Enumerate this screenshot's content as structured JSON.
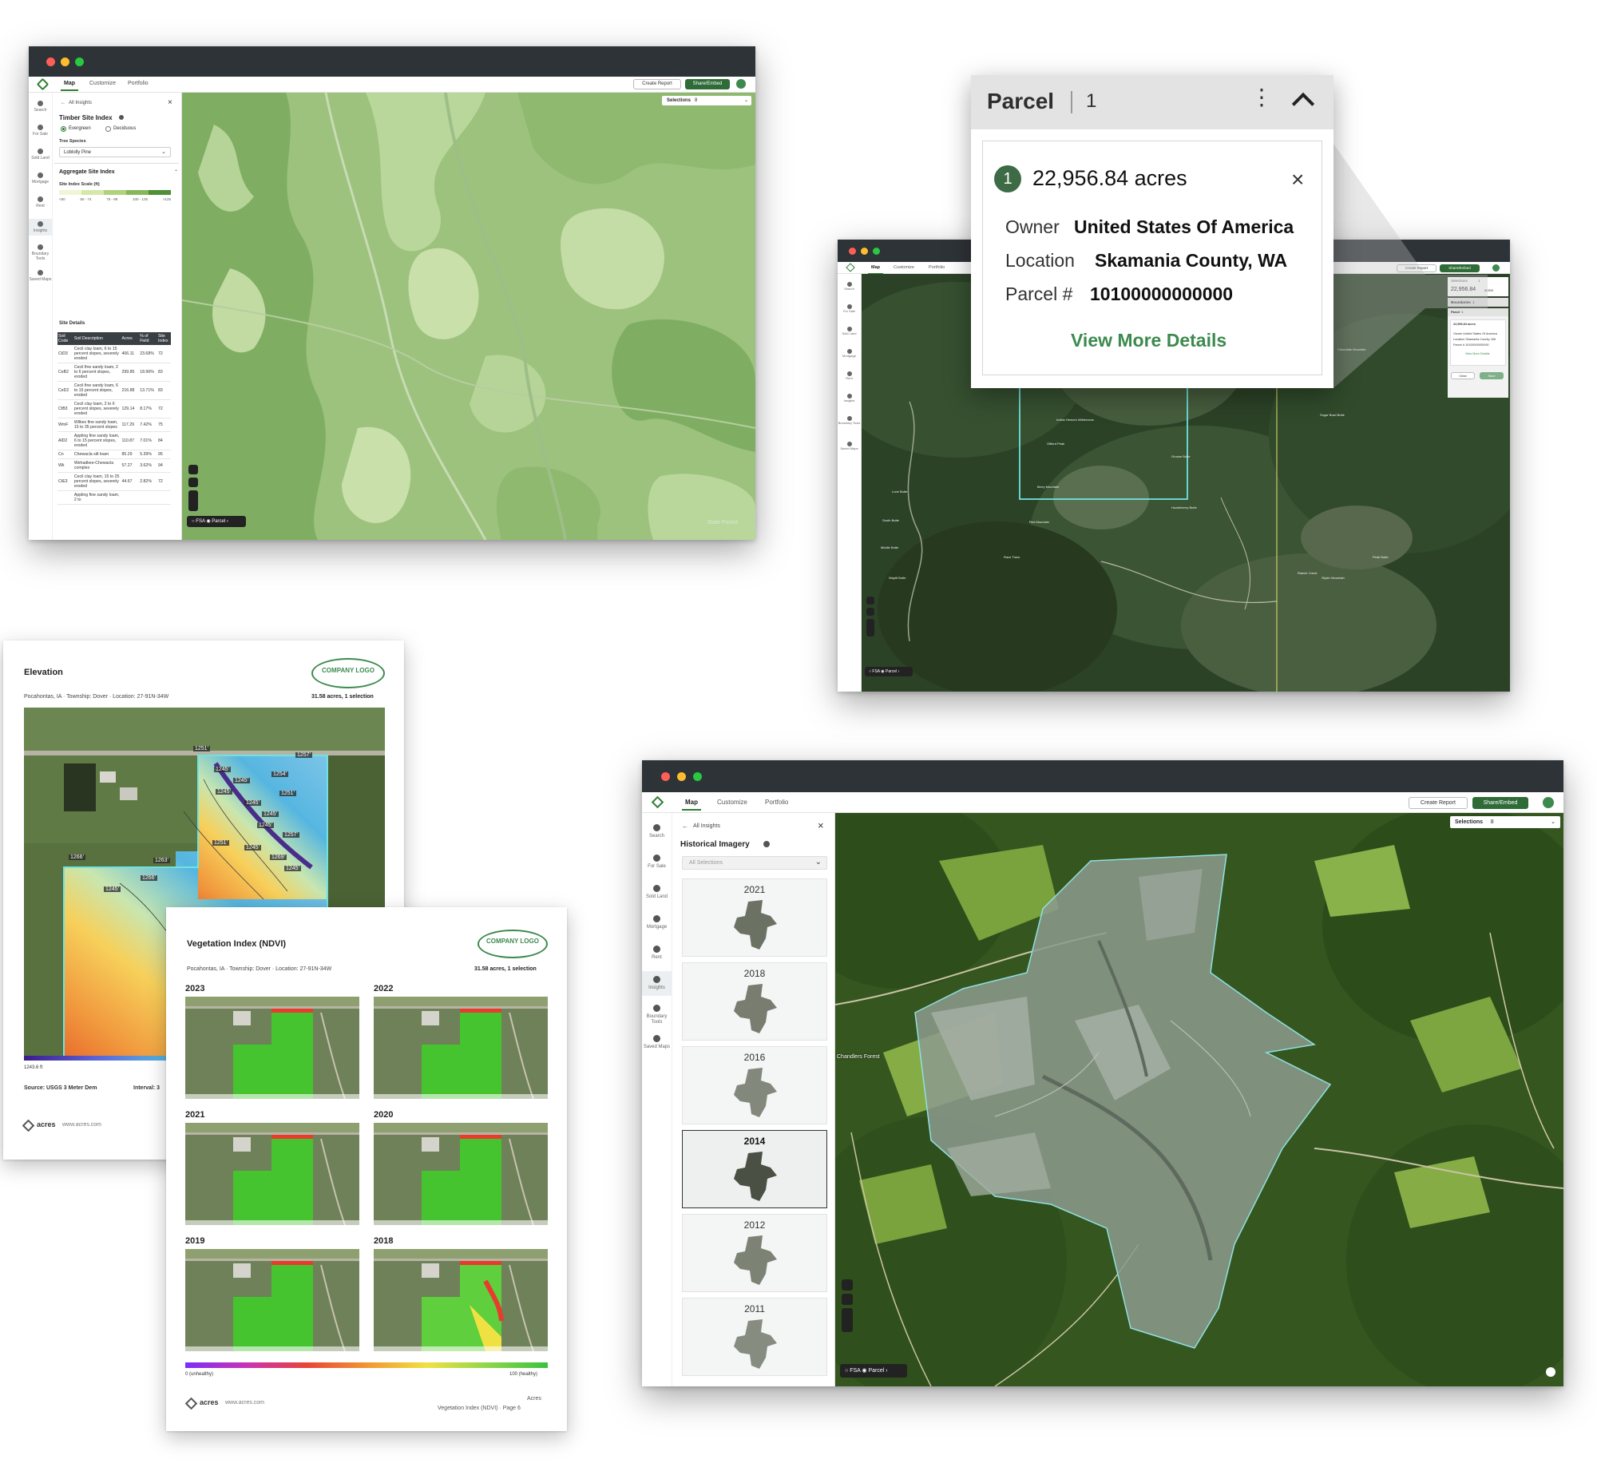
{
  "colors": {
    "brand_green": "#2e6b37",
    "accent_green": "#3c8a4e",
    "titlebar": "#2e3338",
    "traffic_red": "#ff5f57",
    "traffic_yellow": "#febc2e",
    "traffic_green": "#28c840"
  },
  "app": {
    "tabs": [
      "Map",
      "Customize",
      "Portfolio"
    ],
    "create_report": "Create Report",
    "share_embed": "Share/Embed",
    "selections_label": "Selections",
    "selections_count": "8",
    "rail": [
      "Search",
      "For Sale",
      "Sold Land",
      "Mortgage",
      "Rent",
      "Insights",
      "Boundary Tools",
      "Saved Maps"
    ],
    "rail_icons": [
      "search-icon",
      "for-sale-icon",
      "sold-land-icon",
      "mortgage-icon",
      "rent-icon",
      "insights-icon",
      "boundary-tools-icon",
      "saved-maps-icon"
    ],
    "fsa_label": "FSA",
    "parcel_label": "Parcel"
  },
  "timber_window": {
    "back_label": "All Insights",
    "title": "Timber Site Index",
    "radio_evergreen": "Evergreen",
    "radio_deciduous": "Deciduous",
    "tree_species_label": "Tree Species",
    "tree_species_value": "Loblolly Pine",
    "aggregate_title": "Aggregate Site Index",
    "scale_label": "Site Index Scale (ft)",
    "scale_ticks": [
      "<50",
      "50 - 74",
      "75 - 99",
      "100 - 125",
      ">125"
    ],
    "scale_colors": [
      "#f1f5d6",
      "#d6e8a8",
      "#b1d27c",
      "#86b85a",
      "#4f8f37"
    ],
    "site_details_label": "Site Details",
    "table_headers": [
      "Soil Code",
      "Soil Description",
      "Acres",
      "% of Field",
      "Site Index"
    ],
    "table_rows": [
      [
        "CtD3",
        "Cecil clay loam, 6 to 15 percent slopes, severely eroded",
        "406.11",
        "23.68%",
        "72"
      ],
      [
        "CeB2",
        "Cecil fine sandy loam, 2 to 6 percent slopes, eroded",
        "299.85",
        "18.96%",
        "83"
      ],
      [
        "CeD2",
        "Cecil fine sandy loam, 6 to 15 percent slopes, eroded",
        "216.88",
        "13.71%",
        "83"
      ],
      [
        "CtB3",
        "Cecil clay loam, 2 to 6 percent slopes, severely eroded",
        "129.14",
        "8.17%",
        "72"
      ],
      [
        "WmF",
        "Wilkes fine sandy loam, 15 to 35 percent slopes",
        "117.29",
        "7.42%",
        "75"
      ],
      [
        "AlD2",
        "Appling fine sandy loam, 6 to 15 percent slopes, eroded",
        "110.87",
        "7.01%",
        "84"
      ],
      [
        "Cn",
        "Chewacla silt loam",
        "85.29",
        "5.39%",
        "95"
      ],
      [
        "Wk",
        "Wehadkee-Chewacla complex",
        "57.27",
        "3.62%",
        "94"
      ],
      [
        "CtE3",
        "Cecil clay loam, 15 to 25 percent slopes, severely eroded",
        "44.67",
        "2.82%",
        "72"
      ],
      [
        "",
        "Appling fine sandy loam, 2 to",
        "",
        "",
        ""
      ]
    ],
    "map_caption": "State Forest"
  },
  "parcel_popup": {
    "title": "Parcel",
    "count": "1",
    "badge": "1",
    "acres": "22,956.84 acres",
    "owner_label": "Owner",
    "owner_value": "United States Of America",
    "location_label": "Location",
    "location_value": "Skamania County, WA",
    "parcel_label": "Parcel #",
    "parcel_value": "10100000000000",
    "link": "View More Details"
  },
  "parcel_window": {
    "selections_label": "Selections",
    "selections_count": "1",
    "selections_acres": "22,956.84",
    "selections_unit": "acres",
    "boundaries_label": "Boundaries",
    "boundaries_count": "1",
    "parcel_label": "Parcel",
    "parcel_count": "1",
    "mini_acres": "22,956.84 acres",
    "mini_owner": "Owner  United States Of America",
    "mini_location": "Location  Skamania County, WA",
    "mini_parcel": "Parcel #  10100000000000",
    "mini_link": "View More Details",
    "clear_label": "Clear",
    "save_label": "Save",
    "map_labels": [
      "Gifford Peak",
      "Indian Heaven Wilderness",
      "Berry Mountain",
      "Lone Butte",
      "South Butte",
      "Middle Butte",
      "Red Mountain",
      "Huckleberry Butte",
      "Grouse Butte",
      "Race Track",
      "Wapiti Butte",
      "Sugar Bowl Butte",
      "Chocolate Mountain",
      "Peak Butte",
      "Skyler Mountain",
      "Rainier Creek"
    ]
  },
  "elevation_report": {
    "title": "Elevation",
    "logo": "COMPANY LOGO",
    "location": "Pocahontas, IA · Township: Dover · Location: 27-91N-34W",
    "acres": "31.58 acres, 1 selection",
    "contours": [
      "1251'",
      "1257'",
      "1245'",
      "1254'",
      "1245'",
      "1245'",
      "1251'",
      "1245'",
      "1245'",
      "1245'",
      "1257'",
      "1251'",
      "1245'",
      "1269'",
      "1266'",
      "1263'",
      "1266'",
      "1245'",
      "1245'"
    ],
    "legend_min": "1243.6 ft",
    "source": "Source: USGS 3 Meter Dem",
    "interval": "Interval: 3",
    "brand": "acres",
    "url": "www.acres.com"
  },
  "ndvi_report": {
    "title": "Vegetation Index (NDVI)",
    "logo": "COMPANY LOGO",
    "location": "Pocahontas, IA · Township: Dover · Location: 27-91N-34W",
    "acres": "31.58 acres, 1 selection",
    "years": [
      "2023",
      "2022",
      "2021",
      "2020",
      "2019",
      "2018"
    ],
    "legend_min": "0 (unhealthy)",
    "legend_max": "100 (healthy)",
    "brand": "acres",
    "url": "www.acres.com",
    "footer_company": "Acres",
    "footer_page": "Vegetation Index (NDVI)  ·  Page 6"
  },
  "imagery_window": {
    "back_label": "All Insights",
    "title": "Historical Imagery",
    "dropdown_placeholder": "All Selections",
    "years": [
      "2021",
      "2018",
      "2016",
      "2014",
      "2012",
      "2011"
    ],
    "selected_year": "2014",
    "map_label": "Chandlers Forest"
  }
}
